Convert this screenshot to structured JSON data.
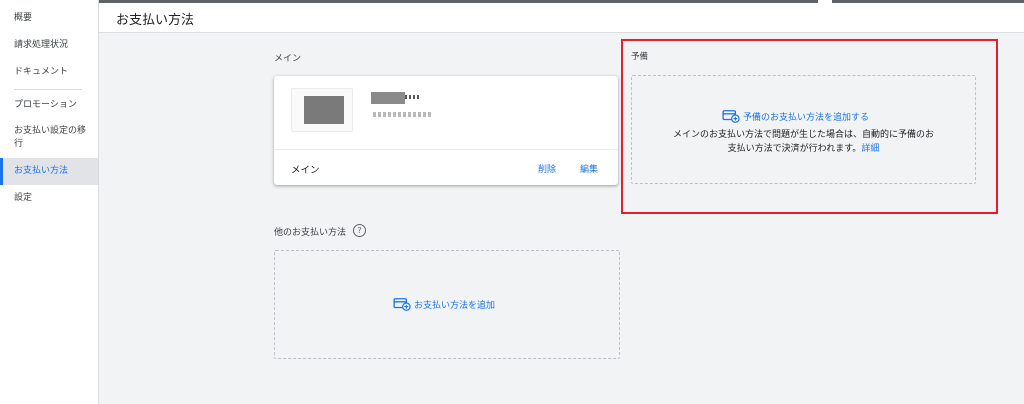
{
  "sidebar": {
    "items": [
      {
        "label": "概要",
        "active": false
      },
      {
        "label": "請求処理状況",
        "active": false
      },
      {
        "label": "ドキュメント",
        "active": false
      },
      {
        "label": "プロモーション",
        "active": false
      },
      {
        "label": "お支払い設定の移行",
        "active": false
      },
      {
        "label": "お支払い方法",
        "active": true
      },
      {
        "label": "設定",
        "active": false
      }
    ]
  },
  "header": {
    "title": "お支払い方法"
  },
  "main_section": {
    "label": "メイン",
    "card": {
      "footer_label": "メイン",
      "delete_label": "削除",
      "edit_label": "編集"
    }
  },
  "backup_section": {
    "label": "予備",
    "add_label": "予備のお支払い方法を追加する",
    "description_line1": "メインのお支払い方法で問題が生じた場合は、自動的に予備のお",
    "description_line2": "支払い方法で決済が行われます。",
    "details_link": "詳細"
  },
  "other_section": {
    "label": "他のお支払い方法",
    "help_icon": "?",
    "add_label": "お支払い方法を追加"
  },
  "colors": {
    "accent": "#1a73e8",
    "highlight": "#e5202e",
    "background": "#f1f3f4"
  },
  "icons": [
    "credit-card-add-icon",
    "help-circle-icon"
  ]
}
